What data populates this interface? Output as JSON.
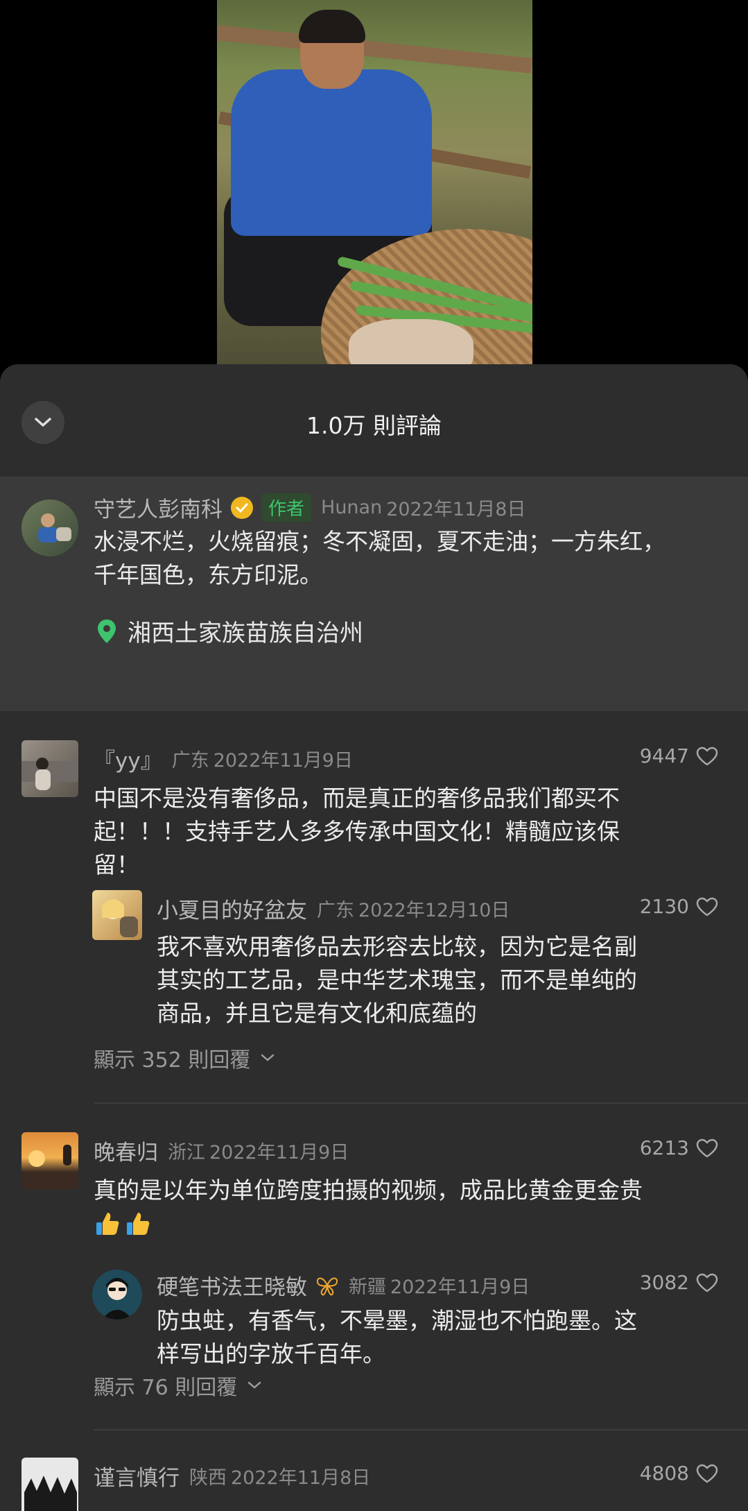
{
  "sheet": {
    "title": "1.0万 則評論"
  },
  "pinned": {
    "username": "守艺人彭南科",
    "author_badge": "作者",
    "region": "Hunan",
    "date": "2022年11月8日",
    "text_line1": "水浸不烂，火烧留痕；冬不凝固，夏不走油；一方朱红，",
    "text_line2": "千年国色，东方印泥。",
    "location": "湘西土家族苗族自治州"
  },
  "comments": [
    {
      "username": "『yy』",
      "region": "广东",
      "date": "2022年11月9日",
      "likes": "9447",
      "text_line1": "中国不是没有奢侈品，而是真正的奢侈品我们都买不",
      "text_line2": "起！！！支持手艺人多多传承中国文化！精髓应该保",
      "text_line3": "留！",
      "reply": {
        "username": "小夏目的好盆友",
        "region": "广东",
        "date": "2022年12月10日",
        "likes": "2130",
        "text_line1": "我不喜欢用奢侈品去形容去比较，因为它是名副",
        "text_line2": "其实的工艺品，是中华艺术瑰宝，而不是单纯的",
        "text_line3": "商品，并且它是有文化和底蕴的"
      },
      "show_replies": "顯示 352 則回覆"
    },
    {
      "username": "晚春归",
      "region": "浙江",
      "date": "2022年11月9日",
      "likes": "6213",
      "text_line1": "真的是以年为单位跨度拍摄的视频，成品比黄金更金贵",
      "reply": {
        "username": "硬笔书法王晓敏",
        "region": "新疆",
        "date": "2022年11月9日",
        "likes": "3082",
        "text_line1": "防虫蛀，有香气，不晕墨，潮湿也不怕跑墨。这",
        "text_line2": "样写出的字放千百年。"
      },
      "show_replies": "顯示 76 則回覆"
    },
    {
      "username": "谨言慎行",
      "region": "陕西",
      "date": "2022年11月8日",
      "likes": "4808"
    }
  ],
  "colors": {
    "sheet_bg": "#2d2d2d",
    "pinned_bg": "#3a3a3a",
    "author_green": "#3ec46d",
    "verified_gold": "#f0b820"
  }
}
